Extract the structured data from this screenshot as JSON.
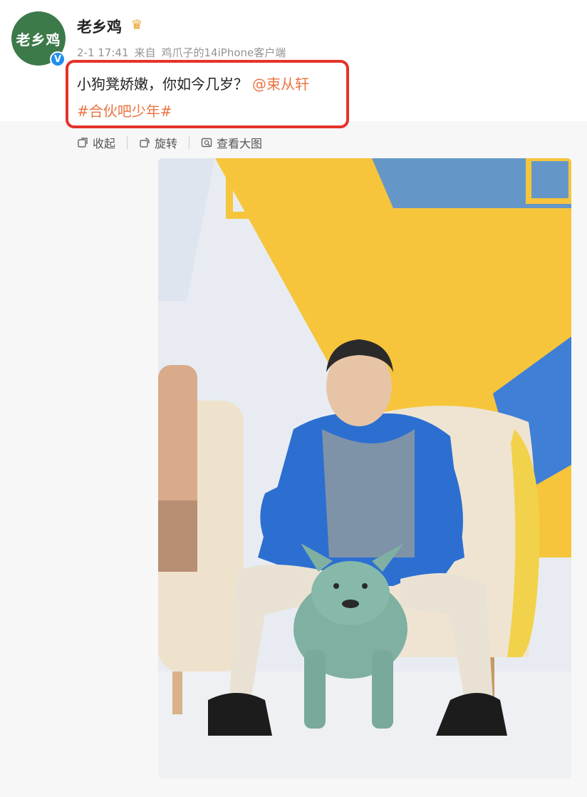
{
  "post": {
    "avatar_text": "老乡鸡",
    "username": "老乡鸡",
    "verified_mark": "V",
    "crown": "♛",
    "date": "2-1 17:41",
    "source_prefix": "来自",
    "source": "鸡爪子的14iPhone客户端",
    "text": "小狗凳娇嫩，你如今几岁？",
    "mention": "@束从轩",
    "hashtag": "#合伙吧少年#"
  },
  "toolbar": {
    "collapse_label": "收起",
    "rotate_label": "旋转",
    "view_full_label": "查看大图"
  },
  "colors": {
    "link": "#eb7340",
    "highlight_border": "#e4332a",
    "avatar_bg": "#3d7a4a",
    "verified": "#1f8ff0"
  }
}
